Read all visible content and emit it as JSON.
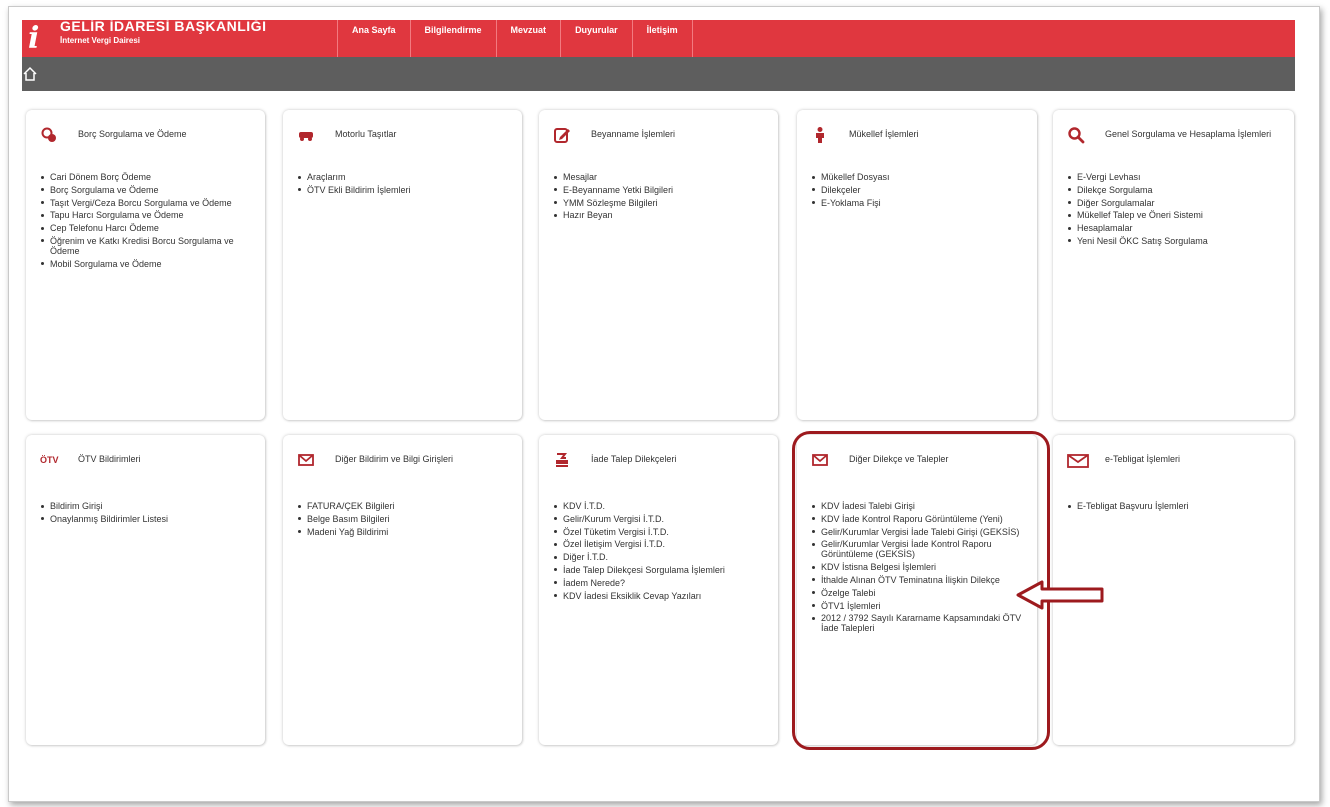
{
  "brand": {
    "title": "GELİR İDARESİ BAŞKANLIĞI",
    "subtitle": "İnternet Vergi Dairesi",
    "logo_letter": "i"
  },
  "nav": [
    "Ana Sayfa",
    "Bilgilendirme",
    "Mevzuat",
    "Duyurular",
    "İletişim"
  ],
  "colors": {
    "header": "#e0373f",
    "subbar": "#5e5e5e",
    "accent": "#b1272d",
    "highlight": "#9d1a1e"
  },
  "cards": [
    {
      "icon": "coins-icon",
      "title": "Borç Sorgulama ve Ödeme",
      "items": [
        "Cari Dönem Borç Ödeme",
        "Borç Sorgulama ve Ödeme",
        "Taşıt Vergi/Ceza Borcu Sorgulama ve Ödeme",
        "Tapu Harcı Sorgulama ve Ödeme",
        "Cep Telefonu Harcı Ödeme",
        "Öğrenim ve Katkı Kredisi Borcu Sorgulama ve Ödeme",
        "Mobil Sorgulama ve Ödeme"
      ]
    },
    {
      "icon": "vehicle-icon",
      "title": "Motorlu Taşıtlar",
      "items": [
        "Araçlarım",
        "ÖTV Ekli Bildirim İşlemleri"
      ]
    },
    {
      "icon": "edit-icon",
      "title": "Beyanname İşlemleri",
      "items": [
        "Mesajlar",
        "E-Beyanname Yetki Bilgileri",
        "YMM Sözleşme Bilgileri",
        "Hazır Beyan"
      ]
    },
    {
      "icon": "person-icon",
      "title": "Mükellef İşlemleri",
      "items": [
        "Mükellef Dosyası",
        "Dilekçeler",
        "E-Yoklama Fişi"
      ]
    },
    {
      "icon": "search-icon",
      "title": "Genel Sorgulama ve Hesaplama İşlemleri",
      "items": [
        "E-Vergi Levhası",
        "Dilekçe Sorgulama",
        "Diğer Sorgulamalar",
        "Mükellef Talep ve Öneri Sistemi",
        "Hesaplamalar",
        "Yeni Nesil ÖKC Satış Sorgulama"
      ]
    },
    {
      "icon": "otv-icon",
      "icon_text": "ÖTV",
      "title": "ÖTV Bildirimleri",
      "items": [
        "Bildirim Girişi",
        "Onaylanmış Bildirimler Listesi"
      ]
    },
    {
      "icon": "envelope-icon",
      "title": "Diğer Bildirim ve Bilgi Girişleri",
      "items": [
        "FATURA/ÇEK Bilgileri",
        "Belge Basım Bilgileri",
        "Madeni Yağ Bildirimi"
      ]
    },
    {
      "icon": "refund-icon",
      "title": "İade Talep Dilekçeleri",
      "items": [
        "KDV İ.T.D.",
        "Gelir/Kurum Vergisi İ.T.D.",
        "Özel Tüketim Vergisi İ.T.D.",
        "Özel İletişim Vergisi İ.T.D.",
        "Diğer İ.T.D.",
        "İade Talep Dilekçesi Sorgulama İşlemleri",
        "İadem Nerede?",
        "KDV İadesi Eksiklik Cevap Yazıları"
      ]
    },
    {
      "icon": "envelope-icon",
      "title": "Diğer Dilekçe ve Talepler",
      "items": [
        "KDV İadesi Talebi Girişi",
        "KDV İade Kontrol Raporu Görüntüleme (Yeni)",
        "Gelir/Kurumlar Vergisi İade Talebi Girişi (GEKSİS)",
        "Gelir/Kurumlar Vergisi İade Kontrol Raporu Görüntüleme (GEKSİS)",
        "KDV İstisna Belgesi İşlemleri",
        "İthalde Alınan ÖTV Teminatına İlişkin Dilekçe",
        "Özelge Talebi",
        "ÖTV1 İşlemleri",
        "2012 / 3792 Sayılı Kararname Kapsamındaki ÖTV İade Talepleri"
      ]
    },
    {
      "icon": "open-envelope-icon",
      "title": "e-Tebligat İşlemleri",
      "items": [
        "E-Tebligat Başvuru İşlemleri"
      ]
    }
  ]
}
